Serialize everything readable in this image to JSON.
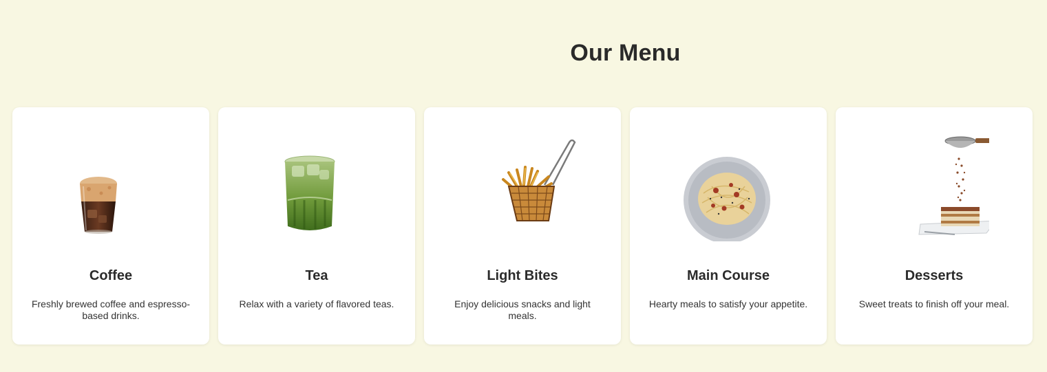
{
  "page": {
    "title": "Our Menu"
  },
  "cards": [
    {
      "icon": "iced-coffee-icon",
      "title": "Coffee",
      "description": "Freshly brewed coffee and espresso-based drinks."
    },
    {
      "icon": "matcha-tea-icon",
      "title": "Tea",
      "description": "Relax with a variety of flavored teas."
    },
    {
      "icon": "fries-basket-icon",
      "title": "Light Bites",
      "description": "Enjoy delicious snacks and light meals."
    },
    {
      "icon": "pasta-plate-icon",
      "title": "Main Course",
      "description": "Hearty meals to satisfy your appetite."
    },
    {
      "icon": "tiramisu-icon",
      "title": "Desserts",
      "description": "Sweet treats to finish off your meal."
    }
  ],
  "colors": {
    "background": "#f8f7e2",
    "card": "#ffffff",
    "text": "#2b2b2b"
  }
}
